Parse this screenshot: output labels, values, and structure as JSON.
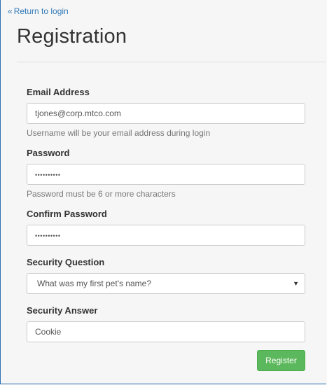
{
  "nav": {
    "return_icon": "double-chevron-left-icon",
    "return_glyph": "«",
    "return_label": "Return to login"
  },
  "header": {
    "title": "Registration"
  },
  "form": {
    "email": {
      "label": "Email Address",
      "value": "tjones@corp.mtco.com",
      "help": "Username will be your email address during login"
    },
    "password": {
      "label": "Password",
      "value": "••••••••••",
      "help": "Password must be 6 or more characters"
    },
    "confirm_password": {
      "label": "Confirm Password",
      "value": "••••••••••"
    },
    "security_question": {
      "label": "Security Question",
      "selected": "What was my first pet's name?",
      "chevron_icon": "caret-down-icon",
      "chevron_glyph": "▼"
    },
    "security_answer": {
      "label": "Security Answer",
      "value": "Cookie"
    },
    "register_label": "Register"
  },
  "colors": {
    "link": "#337ab7",
    "button_bg": "#5cb85c",
    "frame_border": "#2a6fb0",
    "help_text": "#777777"
  }
}
